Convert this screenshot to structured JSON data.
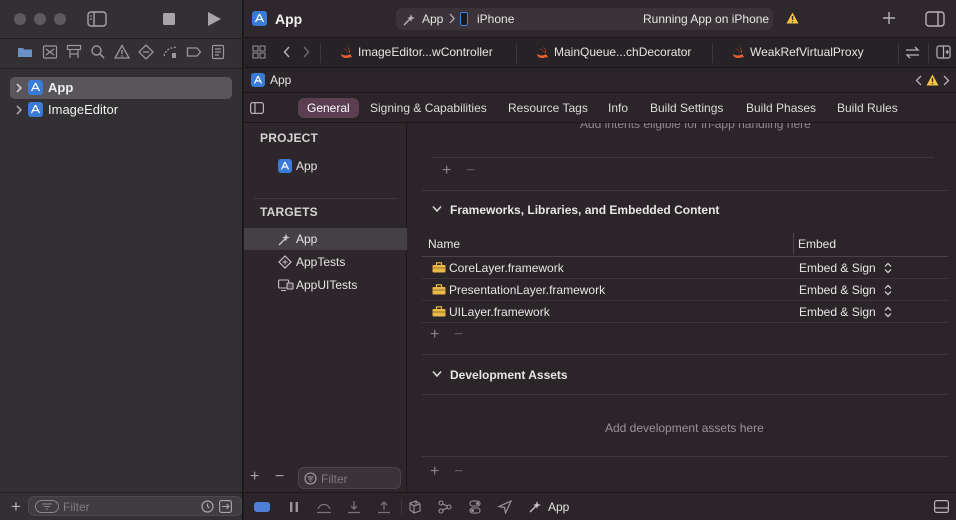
{
  "navigator": {
    "filter_placeholder": "Filter",
    "tree": [
      {
        "label": "App"
      },
      {
        "label": "ImageEditor"
      }
    ]
  },
  "titlebar": {
    "project_title": "App",
    "scheme_name": "App",
    "device_name": "iPhone",
    "status": "Running App on iPhone"
  },
  "tabs": [
    {
      "label": "ImageEditor...wController"
    },
    {
      "label": "MainQueue...chDecorator"
    },
    {
      "label": "WeakRefVirtualProxy"
    }
  ],
  "jumpbar": {
    "crumb": "App"
  },
  "editor_tabs": [
    {
      "label": "General"
    },
    {
      "label": "Signing & Capabilities"
    },
    {
      "label": "Resource Tags"
    },
    {
      "label": "Info"
    },
    {
      "label": "Build Settings"
    },
    {
      "label": "Build Phases"
    },
    {
      "label": "Build Rules"
    }
  ],
  "project_pane": {
    "project_header": "PROJECT",
    "project_items": [
      {
        "label": "App"
      }
    ],
    "targets_header": "TARGETS",
    "targets": [
      {
        "label": "App"
      },
      {
        "label": "AppTests"
      },
      {
        "label": "AppUITests"
      }
    ],
    "filter_placeholder": "Filter"
  },
  "content": {
    "intents_hint": "Add intents eligible for in-app handling here",
    "frameworks_section": {
      "title": "Frameworks, Libraries, and Embedded Content",
      "col_name": "Name",
      "col_embed": "Embed",
      "rows": [
        {
          "name": "CoreLayer.framework",
          "embed": "Embed & Sign"
        },
        {
          "name": "PresentationLayer.framework",
          "embed": "Embed & Sign"
        },
        {
          "name": "UILayer.framework",
          "embed": "Embed & Sign"
        }
      ]
    },
    "assets_section": {
      "title": "Development Assets",
      "placeholder": "Add development assets here"
    }
  },
  "debugbar": {
    "scheme": "App"
  },
  "colors": {
    "accent": "#5b3e50",
    "warning": "#f5c242",
    "swift": "#f0622d",
    "framework_icon": "#e8b84a",
    "app_icon": "#3a7bd5"
  }
}
